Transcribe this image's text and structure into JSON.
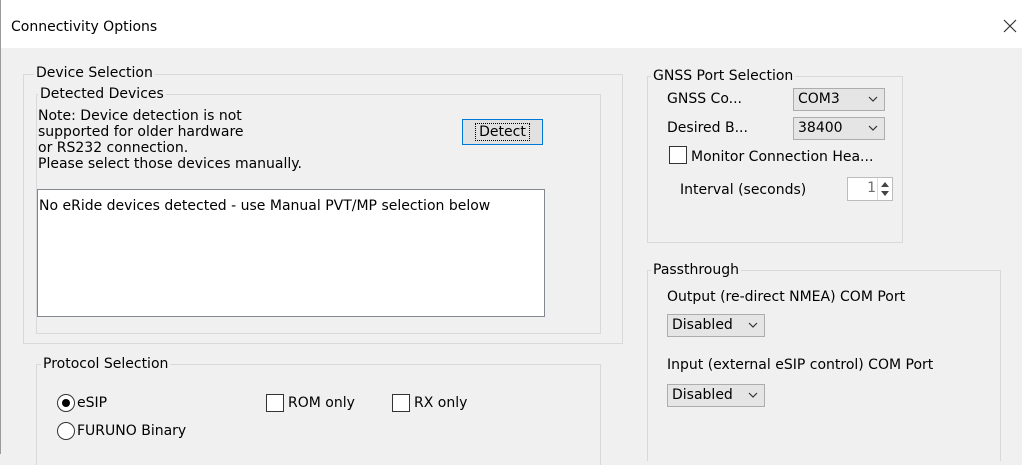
{
  "window": {
    "title": "Connectivity Options",
    "close_icon": "close-icon"
  },
  "device_selection": {
    "legend": "Device Selection",
    "detected": {
      "legend": "Detected Devices",
      "note_lines": [
        "Note: Device detection is not",
        "supported for older hardware",
        "or RS232 connection.",
        "Please select those devices manually."
      ],
      "detect_label": "Detect",
      "list_items": [
        "No eRide devices detected - use Manual PVT/MP selection below"
      ]
    }
  },
  "protocol": {
    "legend": "Protocol Selection",
    "options": [
      {
        "label": "eSIP",
        "selected": true
      },
      {
        "label": "FURUNO Binary",
        "selected": false
      }
    ],
    "rom_only": {
      "label": "ROM only",
      "checked": false
    },
    "rx_only": {
      "label": "RX only",
      "checked": false
    }
  },
  "gnss": {
    "legend": "GNSS Port Selection",
    "com_label": "GNSS Co...",
    "com_value": "COM3",
    "baud_label": "Desired B...",
    "baud_value": "38400",
    "monitor_label": "Monitor Connection Hea...",
    "monitor_checked": false,
    "interval_label": "Interval (seconds)",
    "interval_value": "1"
  },
  "passthrough": {
    "legend": "Passthrough",
    "output_label": "Output (re-direct NMEA) COM Port",
    "output_value": "Disabled",
    "input_label": "Input (external eSIP control) COM Port",
    "input_value": "Disabled"
  }
}
